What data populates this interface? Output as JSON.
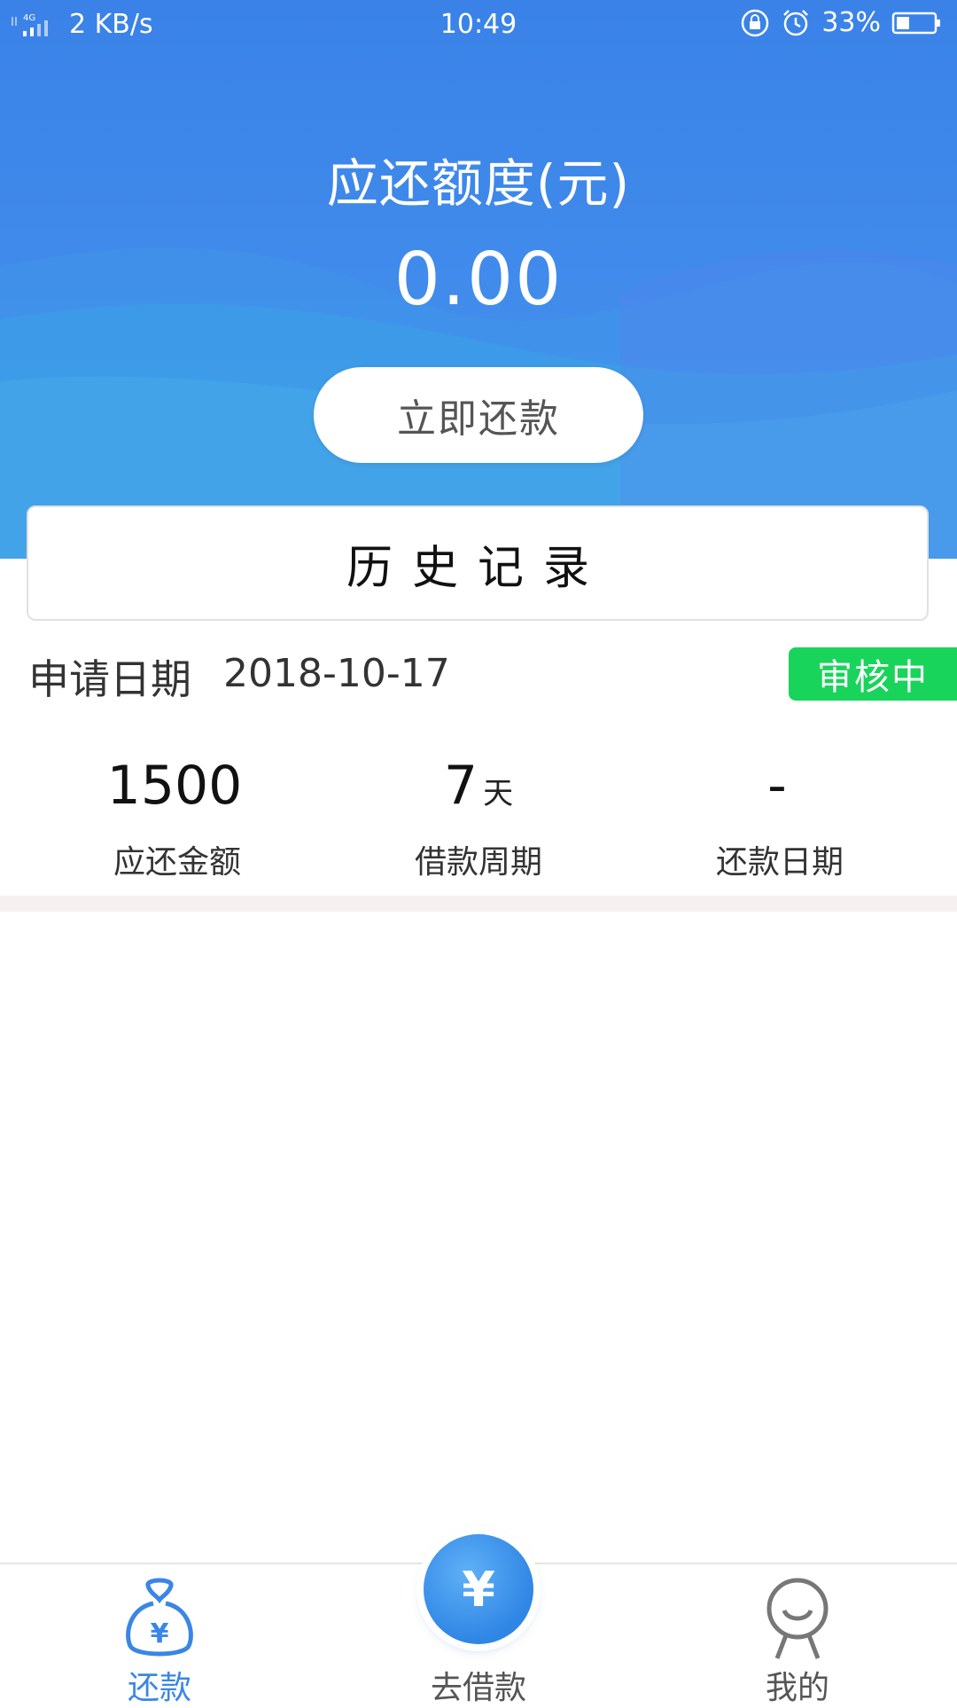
{
  "status_bar": {
    "network_type": "4G",
    "speed": "2 KB/s",
    "time": "10:49",
    "battery": "33%"
  },
  "header": {
    "title": "应还额度(元)",
    "amount": "0.00",
    "repay_button_label": "立即还款",
    "background_color": "#3a82e8"
  },
  "history": {
    "title": "历史记录"
  },
  "application": {
    "date_label": "申请日期",
    "date_value": "2018-10-17",
    "status": "审核中",
    "status_color": "#18d45a"
  },
  "stats": [
    {
      "value": "1500",
      "unit": "",
      "label": "应还金额"
    },
    {
      "value": "7",
      "unit": "天",
      "label": "借款周期"
    },
    {
      "value": "-",
      "unit": "",
      "label": "还款日期"
    }
  ],
  "bottom_nav": {
    "items": [
      {
        "label": "还款",
        "icon": "money-bag-icon",
        "active": true
      },
      {
        "label": "去借款",
        "icon": "yen-coin-icon",
        "active": false
      },
      {
        "label": "我的",
        "icon": "person-icon",
        "active": false
      }
    ],
    "fab_symbol": "¥",
    "active_color": "#3a86e6"
  }
}
